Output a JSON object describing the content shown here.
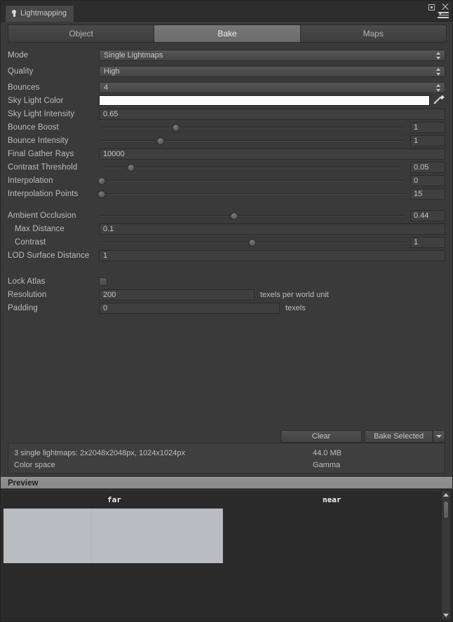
{
  "window": {
    "tab_title": "Lightmapping",
    "icon": "lightbulb-icon",
    "controls": {
      "maximize": "maximize-icon",
      "close": "close-icon",
      "menu": "panel-menu-icon"
    }
  },
  "tabs": [
    {
      "label": "Object",
      "selected": false
    },
    {
      "label": "Bake",
      "selected": true
    },
    {
      "label": "Maps",
      "selected": false
    }
  ],
  "properties": {
    "mode": {
      "label": "Mode",
      "value": "Single Lightmaps",
      "type": "dropdown"
    },
    "quality": {
      "label": "Quality",
      "value": "High",
      "type": "dropdown"
    },
    "bounces": {
      "label": "Bounces",
      "value": "4",
      "type": "dropdown"
    },
    "sky_light_color": {
      "label": "Sky Light Color",
      "value": "#fbfbfb",
      "type": "color"
    },
    "sky_light_intensity": {
      "label": "Sky Light Intensity",
      "value": "0.65",
      "type": "text"
    },
    "bounce_boost": {
      "label": "Bounce Boost",
      "value": "1",
      "type": "slider",
      "fill": 25
    },
    "bounce_intensity": {
      "label": "Bounce Intensity",
      "value": "1",
      "type": "slider",
      "fill": 20
    },
    "final_gather_rays": {
      "label": "Final Gather Rays",
      "value": "10000",
      "type": "text"
    },
    "contrast_threshold": {
      "label": "Contrast Threshold",
      "value": "0.05",
      "type": "slider",
      "fill": 10
    },
    "interpolation": {
      "label": "Interpolation",
      "value": "0",
      "type": "slider",
      "fill": 0
    },
    "interpolation_points": {
      "label": "Interpolation Points",
      "value": "15",
      "type": "slider",
      "fill": 0
    },
    "ambient_occlusion": {
      "label": "Ambient Occlusion",
      "value": "0.44",
      "type": "slider",
      "fill": 44
    },
    "max_distance": {
      "label": "Max Distance",
      "value": "0.1",
      "type": "text"
    },
    "contrast": {
      "label": "Contrast",
      "value": "1",
      "type": "slider",
      "fill": 50
    },
    "lod_surface_distance": {
      "label": "LOD Surface Distance",
      "value": "1",
      "type": "text"
    },
    "lock_atlas": {
      "label": "Lock Atlas",
      "checked": false,
      "type": "checkbox"
    },
    "resolution": {
      "label": "Resolution",
      "value": "200",
      "suffix": "texels per world unit",
      "type": "text"
    },
    "padding": {
      "label": "Padding",
      "value": "0",
      "suffix": "texels",
      "type": "text"
    }
  },
  "actions": {
    "clear": "Clear",
    "bake_selected": "Bake Selected",
    "bake_dropdown": "chevron-down-icon"
  },
  "info": {
    "lightmaps_summary": "3 single lightmaps: 2x2048x2048px, 1024x1024px",
    "memory": "44.0 MB",
    "color_space_label": "Color space",
    "color_space_value": "Gamma"
  },
  "preview": {
    "header": "Preview",
    "far_label": "far",
    "near_label": "near"
  }
}
